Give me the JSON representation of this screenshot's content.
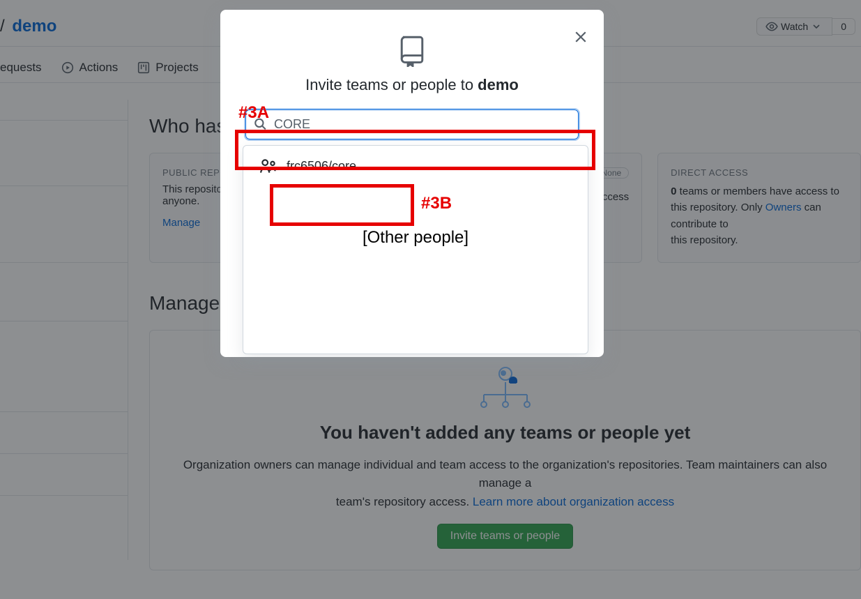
{
  "breadcrumb": {
    "separator": "/",
    "repo": "demo"
  },
  "watch": {
    "label": "Watch",
    "count": "0"
  },
  "nav": {
    "pulls": "equests",
    "actions": "Actions",
    "projects": "Projects"
  },
  "section": {
    "who_has_access": "Who has access"
  },
  "cards": {
    "public": {
      "title": "PUBLIC REPOSITORY",
      "body_1": "This repository is public and visible to",
      "body_2": "anyone.",
      "manage": "Manage"
    },
    "base": {
      "pill": "None",
      "body": "an access"
    },
    "direct": {
      "title": "DIRECT ACCESS",
      "body_bold": "0",
      "body_1": " teams or members have access to this",
      "body_mid": "repository. Only ",
      "owners": "Owners",
      "body_2": " can contribute to",
      "body_3": "this repository."
    }
  },
  "manage_access": {
    "heading": "Manage access"
  },
  "empty": {
    "title": "You haven't added any teams or people yet",
    "line1": "Organization owners can manage individual and team access to the organization's repositories. Team maintainers can also manage a",
    "line2": "team's repository access. ",
    "learn_more": "Learn more about organization access",
    "invite_btn": "Invite teams or people"
  },
  "modal": {
    "title_prefix": "Invite teams or people to ",
    "title_repo": "demo",
    "search_value": "CORE",
    "result": "frc6506/core",
    "other": "[Other people]"
  },
  "annotations": {
    "a": "#3A",
    "b": "#3B"
  }
}
